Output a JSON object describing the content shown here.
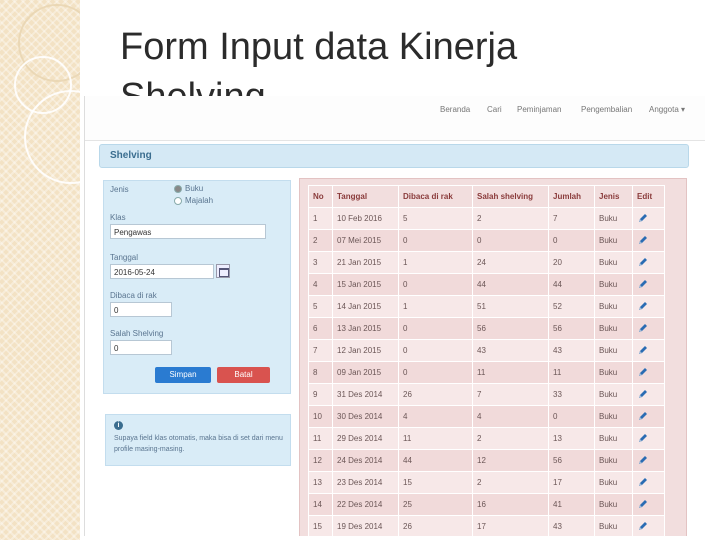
{
  "slide": {
    "title": "Form Input data Kinerja Shelving"
  },
  "nav": {
    "items": [
      "Beranda",
      "Cari",
      "Peminjaman",
      "Pengembalian",
      "Anggota ▾"
    ]
  },
  "section": {
    "title": "Shelving"
  },
  "form": {
    "jenis_label": "Jenis",
    "radio_options": [
      "Buku",
      "Majalah"
    ],
    "radio_selected": "Buku",
    "klas_label": "Klas",
    "klas_value": "Pengawas",
    "tanggal_label": "Tanggal",
    "tanggal_value": "2016-05-24",
    "dibaca_label": "Dibaca di rak",
    "dibaca_value": "0",
    "salah_label": "Salah Shelving",
    "salah_value": "0",
    "save_label": "Simpan",
    "cancel_label": "Batal"
  },
  "info": {
    "icon": "i",
    "text": "Supaya field klas otomatis, maka bisa di set dari menu profile masing-masing."
  },
  "colors": {
    "accent_blue": "#2a7bd1",
    "danger_red": "#d9534f",
    "panel_blue": "#d9ecf7",
    "table_pink": "#f2dede"
  },
  "table": {
    "headers": [
      "No",
      "Tanggal",
      "Dibaca di rak",
      "Salah shelving",
      "Jumlah",
      "Jenis",
      "Edit"
    ],
    "rows": [
      [
        "1",
        "10 Feb 2016",
        "5",
        "2",
        "7",
        "Buku"
      ],
      [
        "2",
        "07 Mei 2015",
        "0",
        "0",
        "0",
        "Buku"
      ],
      [
        "3",
        "21 Jan 2015",
        "1",
        "24",
        "20",
        "Buku"
      ],
      [
        "4",
        "15 Jan 2015",
        "0",
        "44",
        "44",
        "Buku"
      ],
      [
        "5",
        "14 Jan 2015",
        "1",
        "51",
        "52",
        "Buku"
      ],
      [
        "6",
        "13 Jan 2015",
        "0",
        "56",
        "56",
        "Buku"
      ],
      [
        "7",
        "12 Jan 2015",
        "0",
        "43",
        "43",
        "Buku"
      ],
      [
        "8",
        "09 Jan 2015",
        "0",
        "11",
        "11",
        "Buku"
      ],
      [
        "9",
        "31 Des 2014",
        "26",
        "7",
        "33",
        "Buku"
      ],
      [
        "10",
        "30 Des 2014",
        "4",
        "4",
        "0",
        "Buku"
      ],
      [
        "11",
        "29 Des 2014",
        "11",
        "2",
        "13",
        "Buku"
      ],
      [
        "12",
        "24 Des 2014",
        "44",
        "12",
        "56",
        "Buku"
      ],
      [
        "13",
        "23 Des 2014",
        "15",
        "2",
        "17",
        "Buku"
      ],
      [
        "14",
        "22 Des 2014",
        "25",
        "16",
        "41",
        "Buku"
      ],
      [
        "15",
        "19 Des 2014",
        "26",
        "17",
        "43",
        "Buku"
      ]
    ]
  }
}
